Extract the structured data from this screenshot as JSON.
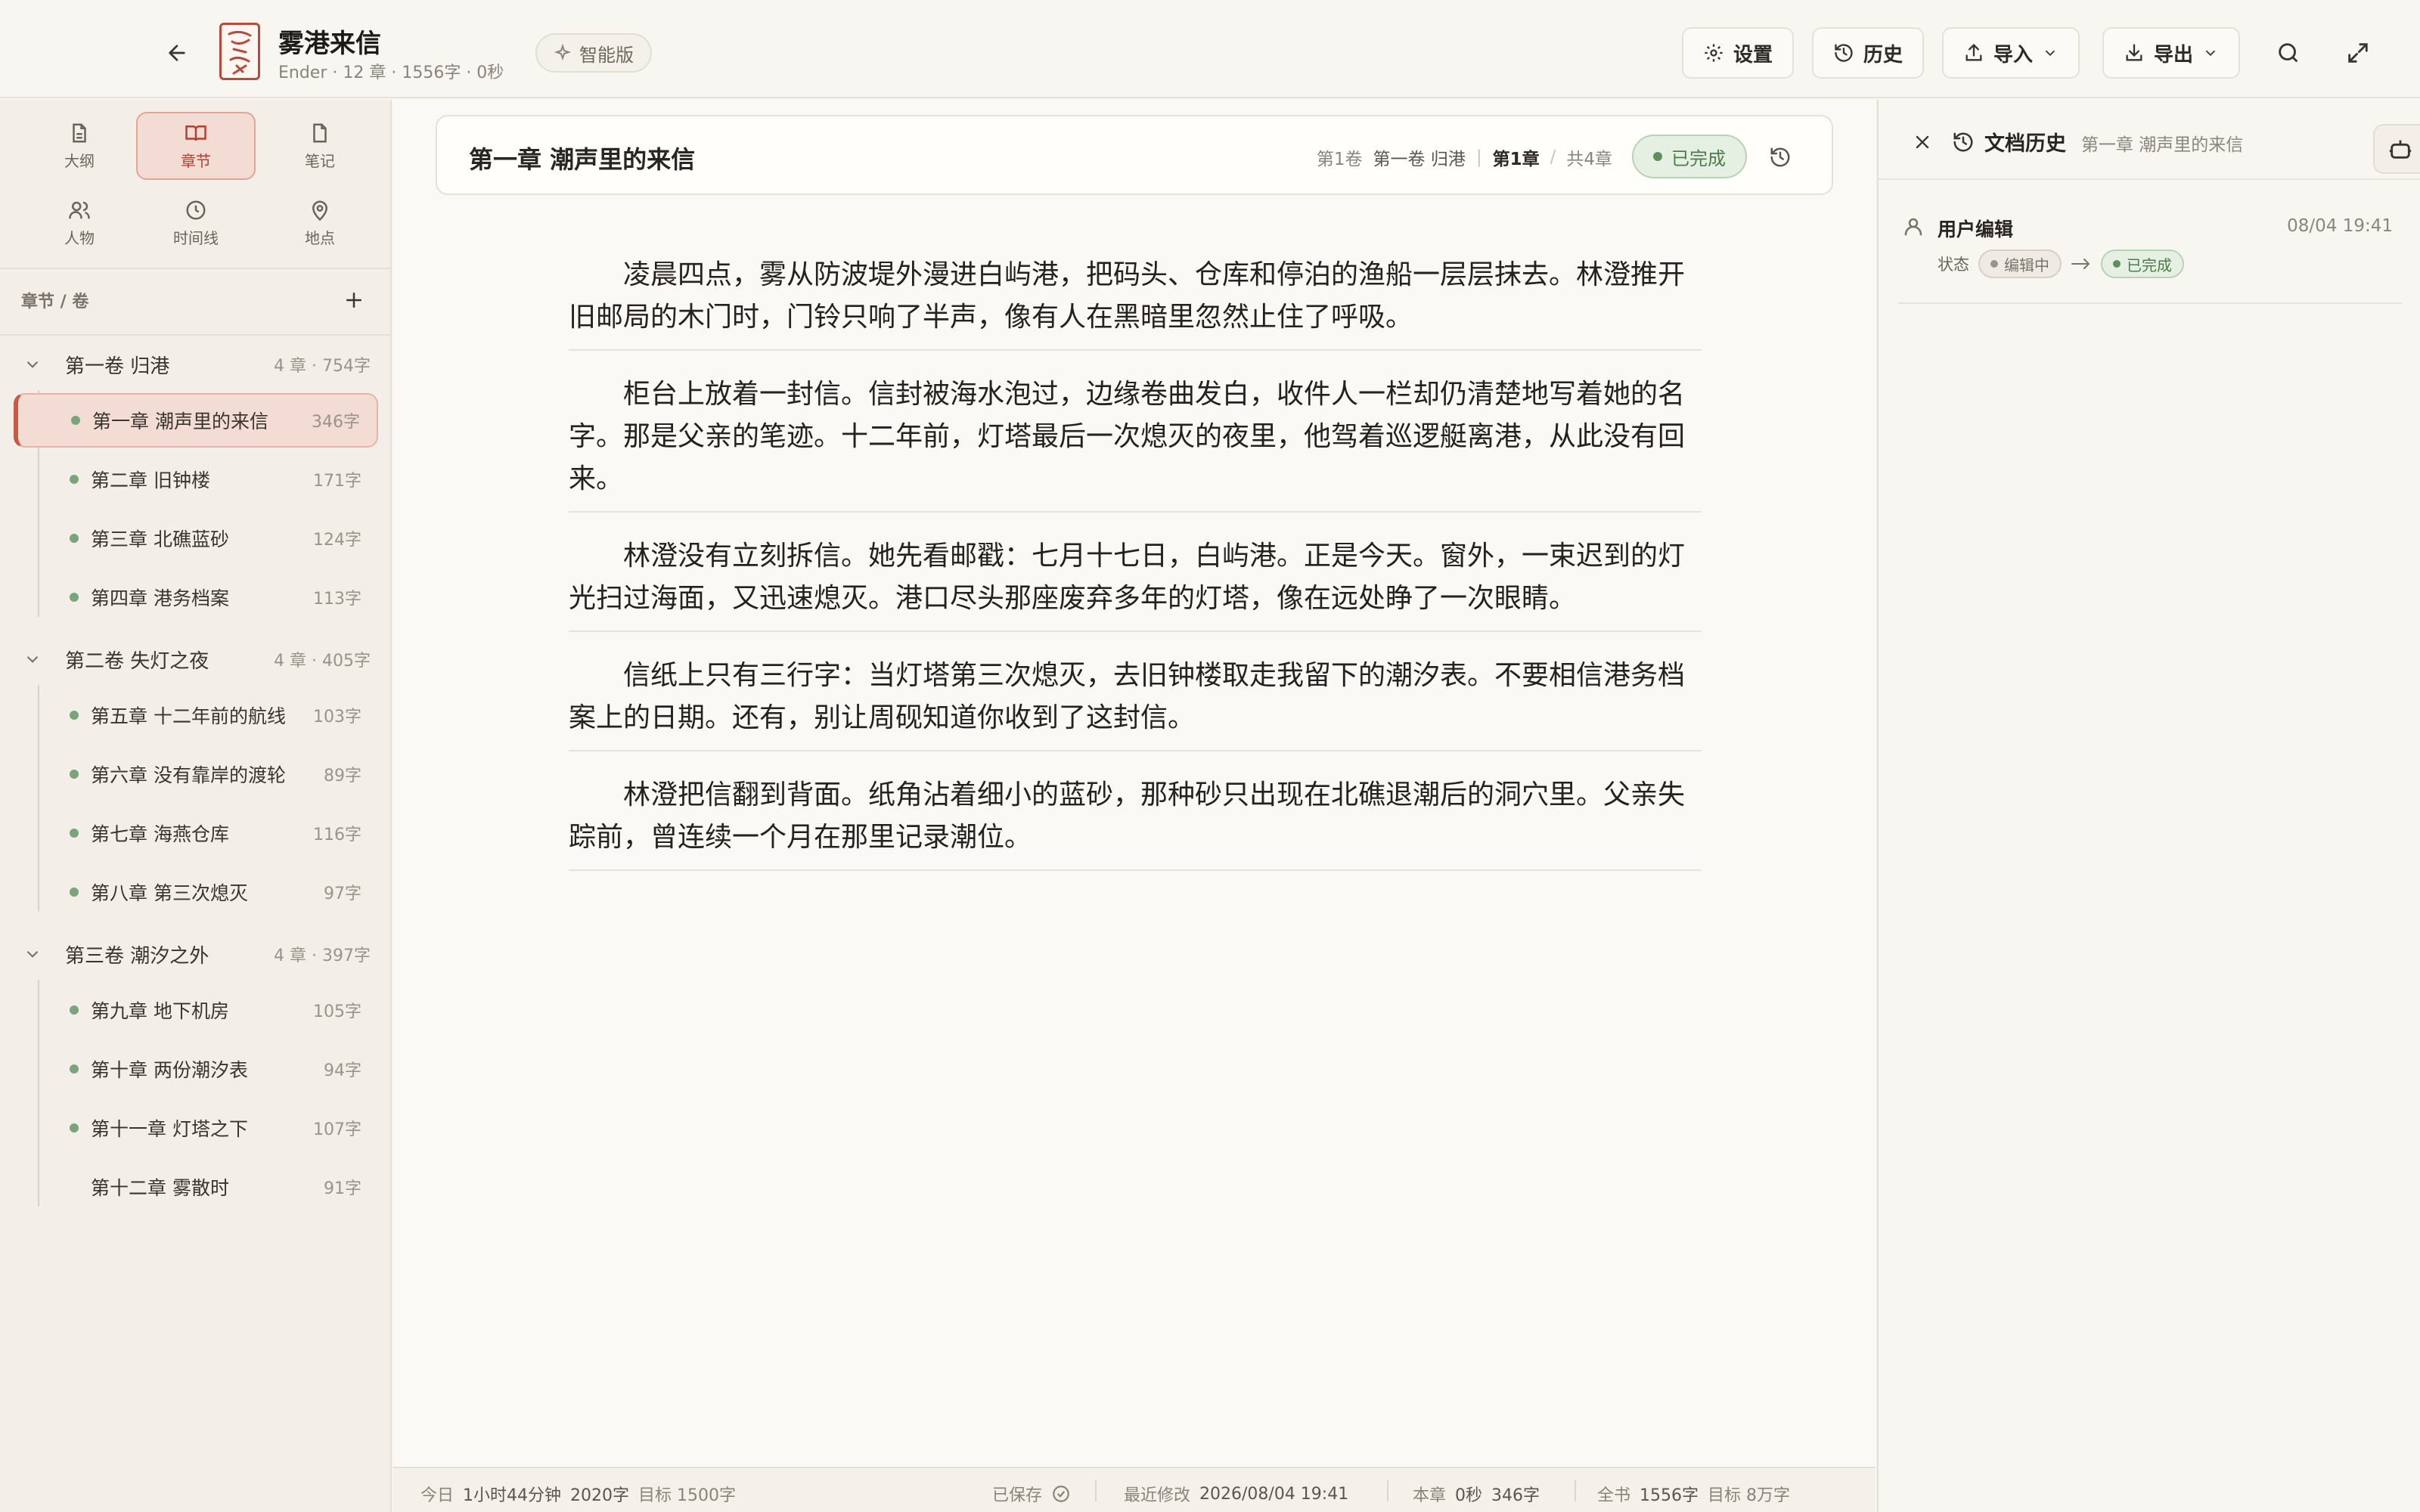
{
  "header": {
    "title": "雾港来信",
    "meta": "Ender · 12 章 · 1556字 · 0秒",
    "logo_text": "雾港",
    "smart_label": "智能版",
    "settings_label": "设置",
    "history_label": "历史",
    "import_label": "导入",
    "export_label": "导出"
  },
  "sidebar": {
    "nav": [
      {
        "label": "大纲",
        "icon": "file-icon"
      },
      {
        "label": "章节",
        "icon": "book-icon"
      },
      {
        "label": "笔记",
        "icon": "note-icon"
      },
      {
        "label": "人物",
        "icon": "people-icon"
      },
      {
        "label": "时间线",
        "icon": "clock-icon"
      },
      {
        "label": "地点",
        "icon": "location-icon"
      }
    ],
    "section_title": "章节 / 卷",
    "volumes": [
      {
        "title": "第一卷 归港",
        "count": "4 章 · 754字",
        "chapters": [
          {
            "title": "第一章 潮声里的来信",
            "count": "346字"
          },
          {
            "title": "第二章 旧钟楼",
            "count": "171字"
          },
          {
            "title": "第三章 北礁蓝砂",
            "count": "124字"
          },
          {
            "title": "第四章 港务档案",
            "count": "113字"
          }
        ]
      },
      {
        "title": "第二卷 失灯之夜",
        "count": "4 章 · 405字",
        "chapters": [
          {
            "title": "第五章 十二年前的航线",
            "count": "103字"
          },
          {
            "title": "第六章 没有靠岸的渡轮",
            "count": "89字"
          },
          {
            "title": "第七章 海燕仓库",
            "count": "116字"
          },
          {
            "title": "第八章 第三次熄灭",
            "count": "97字"
          }
        ]
      },
      {
        "title": "第三卷 潮汐之外",
        "count": "4 章 · 397字",
        "chapters": [
          {
            "title": "第九章 地下机房",
            "count": "105字"
          },
          {
            "title": "第十章 两份潮汐表",
            "count": "94字"
          },
          {
            "title": "第十一章 灯塔之下",
            "count": "107字"
          },
          {
            "title": "第十二章 雾散时",
            "count": "91字"
          }
        ]
      }
    ]
  },
  "editor": {
    "chapter_title": "第一章 潮声里的来信",
    "crumb_volume_num": "第1卷",
    "crumb_volume_name": "第一卷 归港",
    "crumb_chapter": "第1章",
    "crumb_total": "共4章",
    "status": "已完成",
    "paragraphs": [
      "凌晨四点，雾从防波堤外漫进白屿港，把码头、仓库和停泊的渔船一层层抹去。林澄推开旧邮局的木门时，门铃只响了半声，像有人在黑暗里忽然止住了呼吸。",
      "柜台上放着一封信。信封被海水泡过，边缘卷曲发白，收件人一栏却仍清楚地写着她的名字。那是父亲的笔迹。十二年前，灯塔最后一次熄灭的夜里，他驾着巡逻艇离港，从此没有回来。",
      "林澄没有立刻拆信。她先看邮戳：七月十七日，白屿港。正是今天。窗外，一束迟到的灯光扫过海面，又迅速熄灭。港口尽头那座废弃多年的灯塔，像在远处睁了一次眼睛。",
      "信纸上只有三行字：当灯塔第三次熄灭，去旧钟楼取走我留下的潮汐表。不要相信港务档案上的日期。还有，别让周砚知道你收到了这封信。",
      "林澄把信翻到背面。纸角沾着细小的蓝砂，那种砂只出现在北礁退潮后的洞穴里。父亲失踪前，曾连续一个月在那里记录潮位。"
    ]
  },
  "statusbar": {
    "today_label": "今日",
    "today_time": "1小时44分钟",
    "today_words": "2020字",
    "today_goal": "目标 1500字",
    "saved": "已保存",
    "modified_label": "最近修改",
    "modified_value": "2026/08/04 19:41",
    "chapter_label": "本章",
    "chapter_time": "0秒",
    "chapter_words": "346字",
    "book_label": "全书",
    "book_words": "1556字",
    "book_goal": "目标 8万字"
  },
  "history_panel": {
    "title": "文档历史",
    "subtitle": "第一章 潮声里的来信",
    "entries": [
      {
        "user": "用户编辑",
        "time": "08/04 19:41",
        "field": "状态",
        "from": "编辑中",
        "to": "已完成"
      }
    ]
  },
  "colors": {
    "accent": "#b43f2e",
    "done_green": "#5f8f5b",
    "background": "#f7f5f0"
  }
}
